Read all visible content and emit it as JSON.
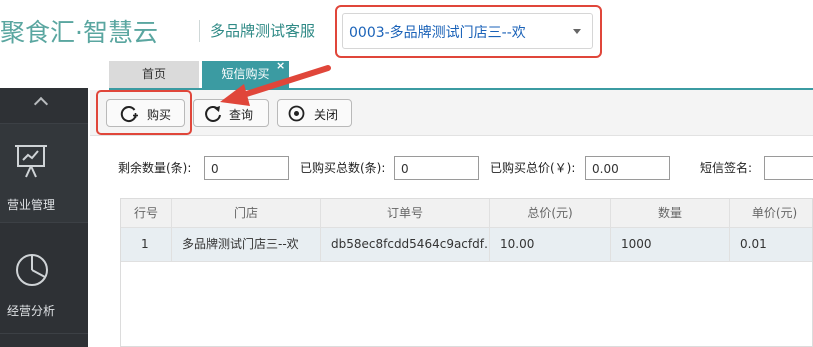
{
  "header": {
    "logo": "聚食汇·智慧云",
    "service": "多品牌测试客服",
    "store_selected": "0003-多品牌测试门店三--欢"
  },
  "tabs": [
    {
      "label": "首页",
      "active": false
    },
    {
      "label": "短信购买",
      "active": true,
      "close": "×"
    }
  ],
  "sidebar": {
    "items": [
      {
        "label": "营业管理",
        "icon": "presentation-board-icon"
      },
      {
        "label": "经营分析",
        "icon": "pie-chart-icon"
      }
    ]
  },
  "toolbar": {
    "buy_label": "购买",
    "query_label": "查询",
    "close_label": "关闭"
  },
  "form": {
    "remaining_label": "剩余数量(条):",
    "remaining_value": "0",
    "purchased_label": "已购买总数(条):",
    "purchased_value": "0",
    "total_price_label": "已购买总价(￥):",
    "total_price_value": "0.00",
    "signature_label": "短信签名:",
    "signature_value": ""
  },
  "table": {
    "columns": [
      "行号",
      "门店",
      "订单号",
      "总价(元)",
      "数量",
      "单价(元)"
    ],
    "rows": [
      [
        "1",
        "多品牌测试门店三--欢",
        "db58ec8fcdd5464c9acfdf…",
        "10.00",
        "1000",
        "0.01"
      ]
    ]
  },
  "colors": {
    "brand_teal": "#3b9ba2",
    "highlight_red": "#e0463a",
    "sidebar_bg": "#2e3135",
    "store_text_blue": "#1a62b8"
  }
}
